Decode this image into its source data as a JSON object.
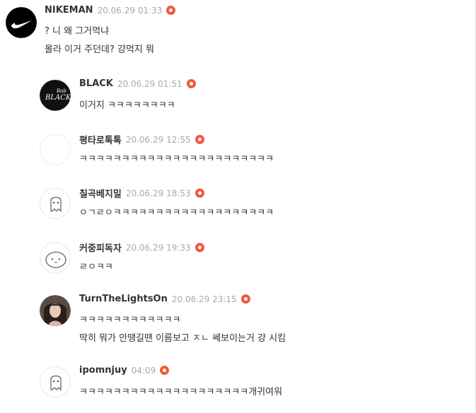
{
  "comments": [
    {
      "nickname": "NIKEMAN",
      "date": "20.06.29 01:33",
      "lines": [
        "? 니 왜 그거먹냐",
        "몰라 이거 주던데? 걍먹지 뭐"
      ],
      "avatar": "nike-logo-avatar"
    },
    {
      "nickname": "BLACK",
      "date": "20.06.29 01:51",
      "lines": [
        "이거지 ㅋㅋㅋㅋㅋㅋㅋㅋ"
      ],
      "avatar": "black-logo-avatar",
      "avatar_text_small": "Bab",
      "avatar_text": "BLACK"
    },
    {
      "nickname": "평타로톡톡",
      "date": "20.06.29 12:55",
      "lines": [
        "ㅋㅋㅋㅋㅋㅋㅋㅋㅋㅋㅋㅋㅋㅋㅋㅋㅋㅋㅋㅋㅋㅋㅋ"
      ],
      "avatar": "blank-avatar"
    },
    {
      "nickname": "칠곡베지밀",
      "date": "20.06.29 18:53",
      "lines": [
        "ㅇㄱㄹㅇㅋㅋㅋㅋㅋㅋㅋㅋㅋㅋㅋㅋㅋㅋㅋㅋㅋㅋㅋ"
      ],
      "avatar": "ghost-avatar"
    },
    {
      "nickname": "커중피독자",
      "date": "20.06.29 19:33",
      "lines": [
        "ㄹㅇㅋㅋ"
      ],
      "avatar": "blob-avatar"
    },
    {
      "nickname": "TurnTheLightsOn",
      "date": "20.06.29 23:15",
      "lines": [
        "ㅋㅋㅋㅋㅋㅋㅋㅋㅋㅋㅋㅋ",
        "딱히 뭐가 안땡길땐 이름보고 ㅈㄴ 쎄보이는거 걍 시킴"
      ],
      "avatar": "photo-avatar"
    },
    {
      "nickname": "ipomnjuy",
      "date": "04:09",
      "lines": [
        "ㅋㅋㅋㅋㅋㅋㅋㅋㅋㅋㅋㅋㅋㅋㅋㅋㅋㅋㅋㅋ개귀여워"
      ],
      "avatar": "ghost-avatar"
    }
  ],
  "colors": {
    "badge": "#ee5a3b",
    "date": "#aaaaaa",
    "nickname": "#333333"
  }
}
